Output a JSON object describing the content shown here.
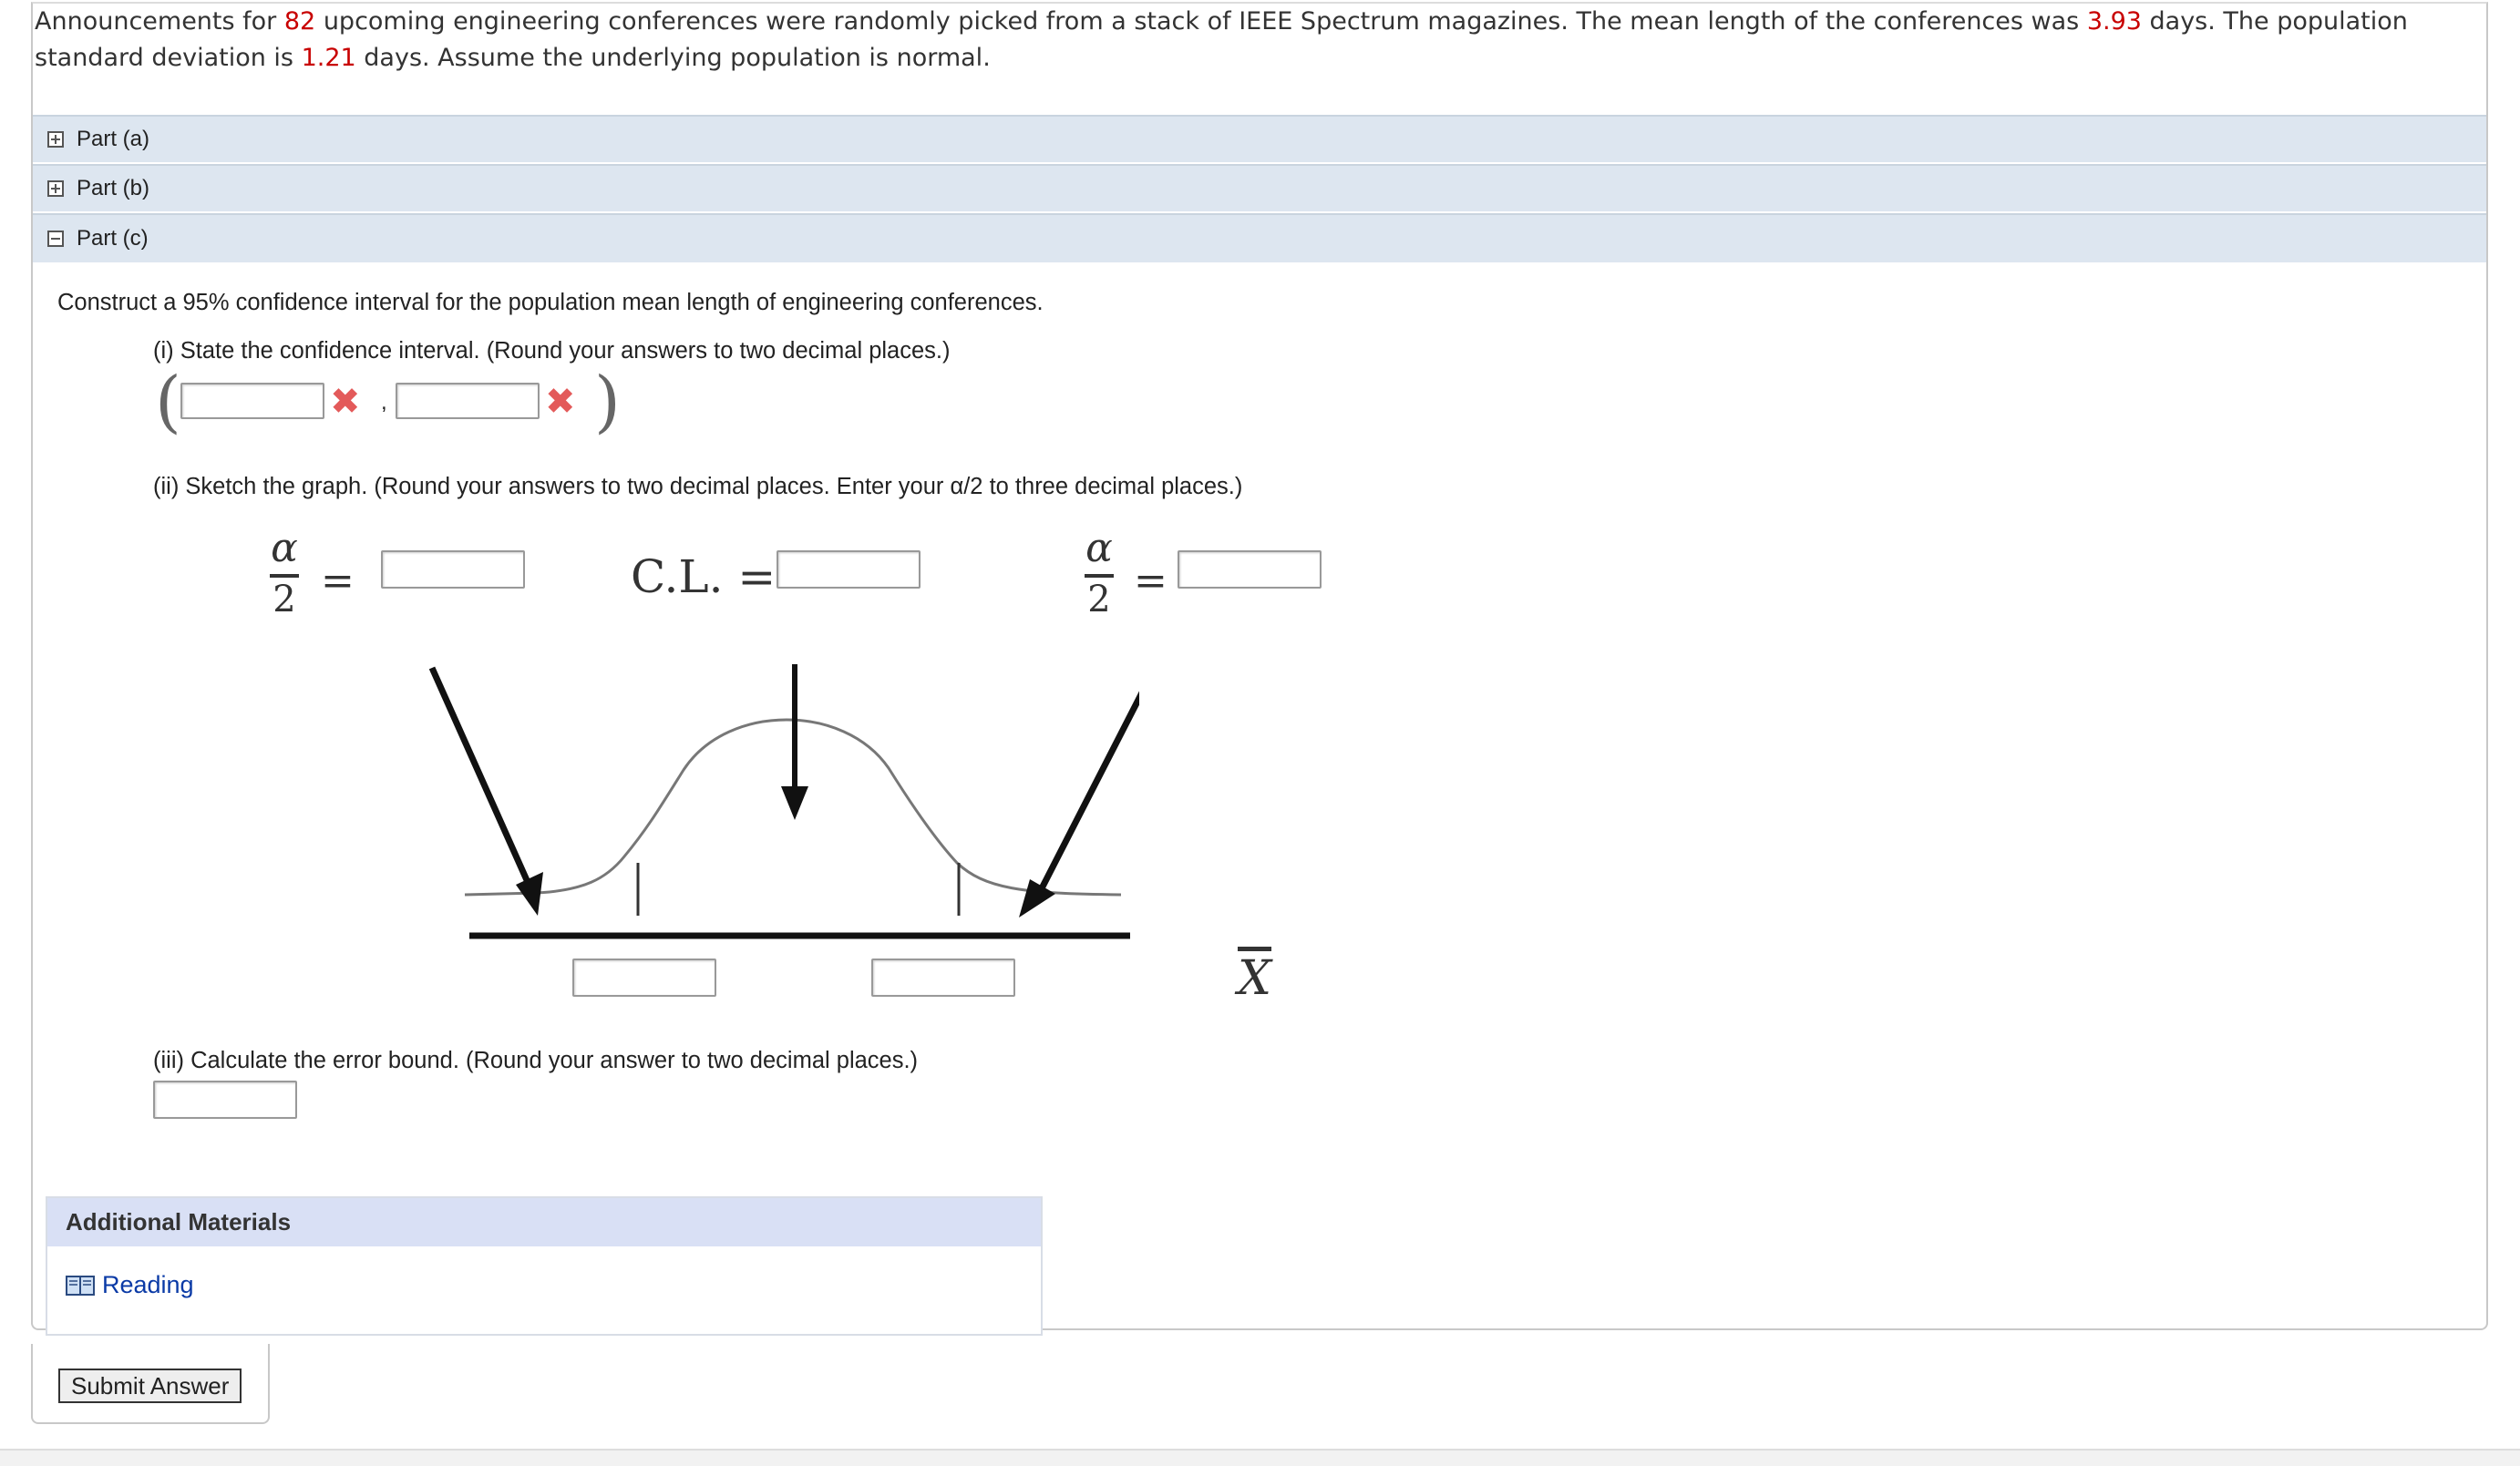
{
  "intro": {
    "t1": "Announcements for ",
    "n_conferences": "82",
    "t2": " upcoming engineering conferences were randomly picked from a stack of IEEE Spectrum magazines. The mean length of the conferences was ",
    "mean": "3.93",
    "t3": " days. The population standard deviation is ",
    "sd": "1.21",
    "t4": " days. Assume the underlying population is normal."
  },
  "parts": [
    {
      "label": "Part (a)",
      "expanded": false
    },
    {
      "label": "Part (b)",
      "expanded": false
    },
    {
      "label": "Part (c)",
      "expanded": true
    }
  ],
  "part_c": {
    "prompt": "Construct a 95% confidence interval for the population mean length of engineering conferences.",
    "q1": "(i) State the confidence interval. (Round your answers to two decimal places.)",
    "q1_lower_value": "",
    "q1_upper_value": "",
    "q1_comma": ",",
    "q2": "(ii) Sketch the graph. (Round your answers to two decimal places. Enter your α/2 to three decimal places.)",
    "alpha_num": "α",
    "alpha_den": "2",
    "equals": "=",
    "cl_label": "C.L. =",
    "xbar_label": "X",
    "q3": "(iii) Calculate the error bound. (Round your answer to two decimal places.)"
  },
  "additional_materials": {
    "title": "Additional Materials",
    "link": "Reading"
  },
  "submit_label": "Submit Answer",
  "colors": {
    "accent_red": "#c80000",
    "error_x": "#e35a5a",
    "part_bar": "#dde6f0",
    "link": "#0a3aa6"
  },
  "icons": {
    "error": "close-icon",
    "expand": "plus-square-icon",
    "collapse": "minus-square-icon",
    "book": "book-icon"
  }
}
